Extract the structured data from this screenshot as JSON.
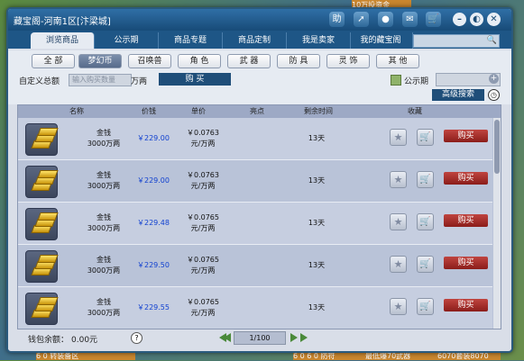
{
  "window": {
    "title": "藏宝阁-河南1区[汴梁城]"
  },
  "titlebar_buttons": {
    "help": "助"
  },
  "tabs": [
    "浏览商品",
    "公示期",
    "商品专题",
    "商品定制",
    "我是卖家",
    "我的藏宝阁"
  ],
  "categories": [
    "全 部",
    "梦幻币",
    "召唤兽",
    "角 色",
    "武 器",
    "防 具",
    "灵 饰",
    "其 他"
  ],
  "filter": {
    "total_label": "自定义总额",
    "qty_placeholder": "输入购买数量",
    "unit": "万两",
    "buy_label": "购 买",
    "public_label": "公示期",
    "advanced_search_label": "高级搜索"
  },
  "table": {
    "headers": [
      "名称",
      "价钱",
      "单价",
      "亮点",
      "剩余时间",
      "收藏"
    ],
    "rows": [
      {
        "name": "金钱",
        "amount": "3000万两",
        "price": "￥229.00",
        "unit_price": "￥0.0763",
        "unit_suffix": "元/万两",
        "time": "13天",
        "buy": "购买"
      },
      {
        "name": "金钱",
        "amount": "3000万两",
        "price": "￥229.00",
        "unit_price": "￥0.0763",
        "unit_suffix": "元/万两",
        "time": "13天",
        "buy": "购买"
      },
      {
        "name": "金钱",
        "amount": "3000万两",
        "price": "￥229.48",
        "unit_price": "￥0.0765",
        "unit_suffix": "元/万两",
        "time": "13天",
        "buy": "购买"
      },
      {
        "name": "金钱",
        "amount": "3000万两",
        "price": "￥229.50",
        "unit_price": "￥0.0765",
        "unit_suffix": "元/万两",
        "time": "13天",
        "buy": "购买"
      },
      {
        "name": "金钱",
        "amount": "3000万两",
        "price": "￥229.55",
        "unit_price": "￥0.0765",
        "unit_suffix": "元/万两",
        "time": "13天",
        "buy": "购买"
      }
    ]
  },
  "footer": {
    "wallet_label": "钱包余额：",
    "wallet_value": "0.00元",
    "help": "?",
    "page": "1/100"
  },
  "background_text": [
    "10万投资金",
    "6 0 转装备区",
    "6 0 6 0 防符",
    "最低爆70武器",
    "6070套装8070"
  ],
  "colors": {
    "accent": "#1f4e79",
    "buy": "#a8302c",
    "price": "#1040d0"
  }
}
